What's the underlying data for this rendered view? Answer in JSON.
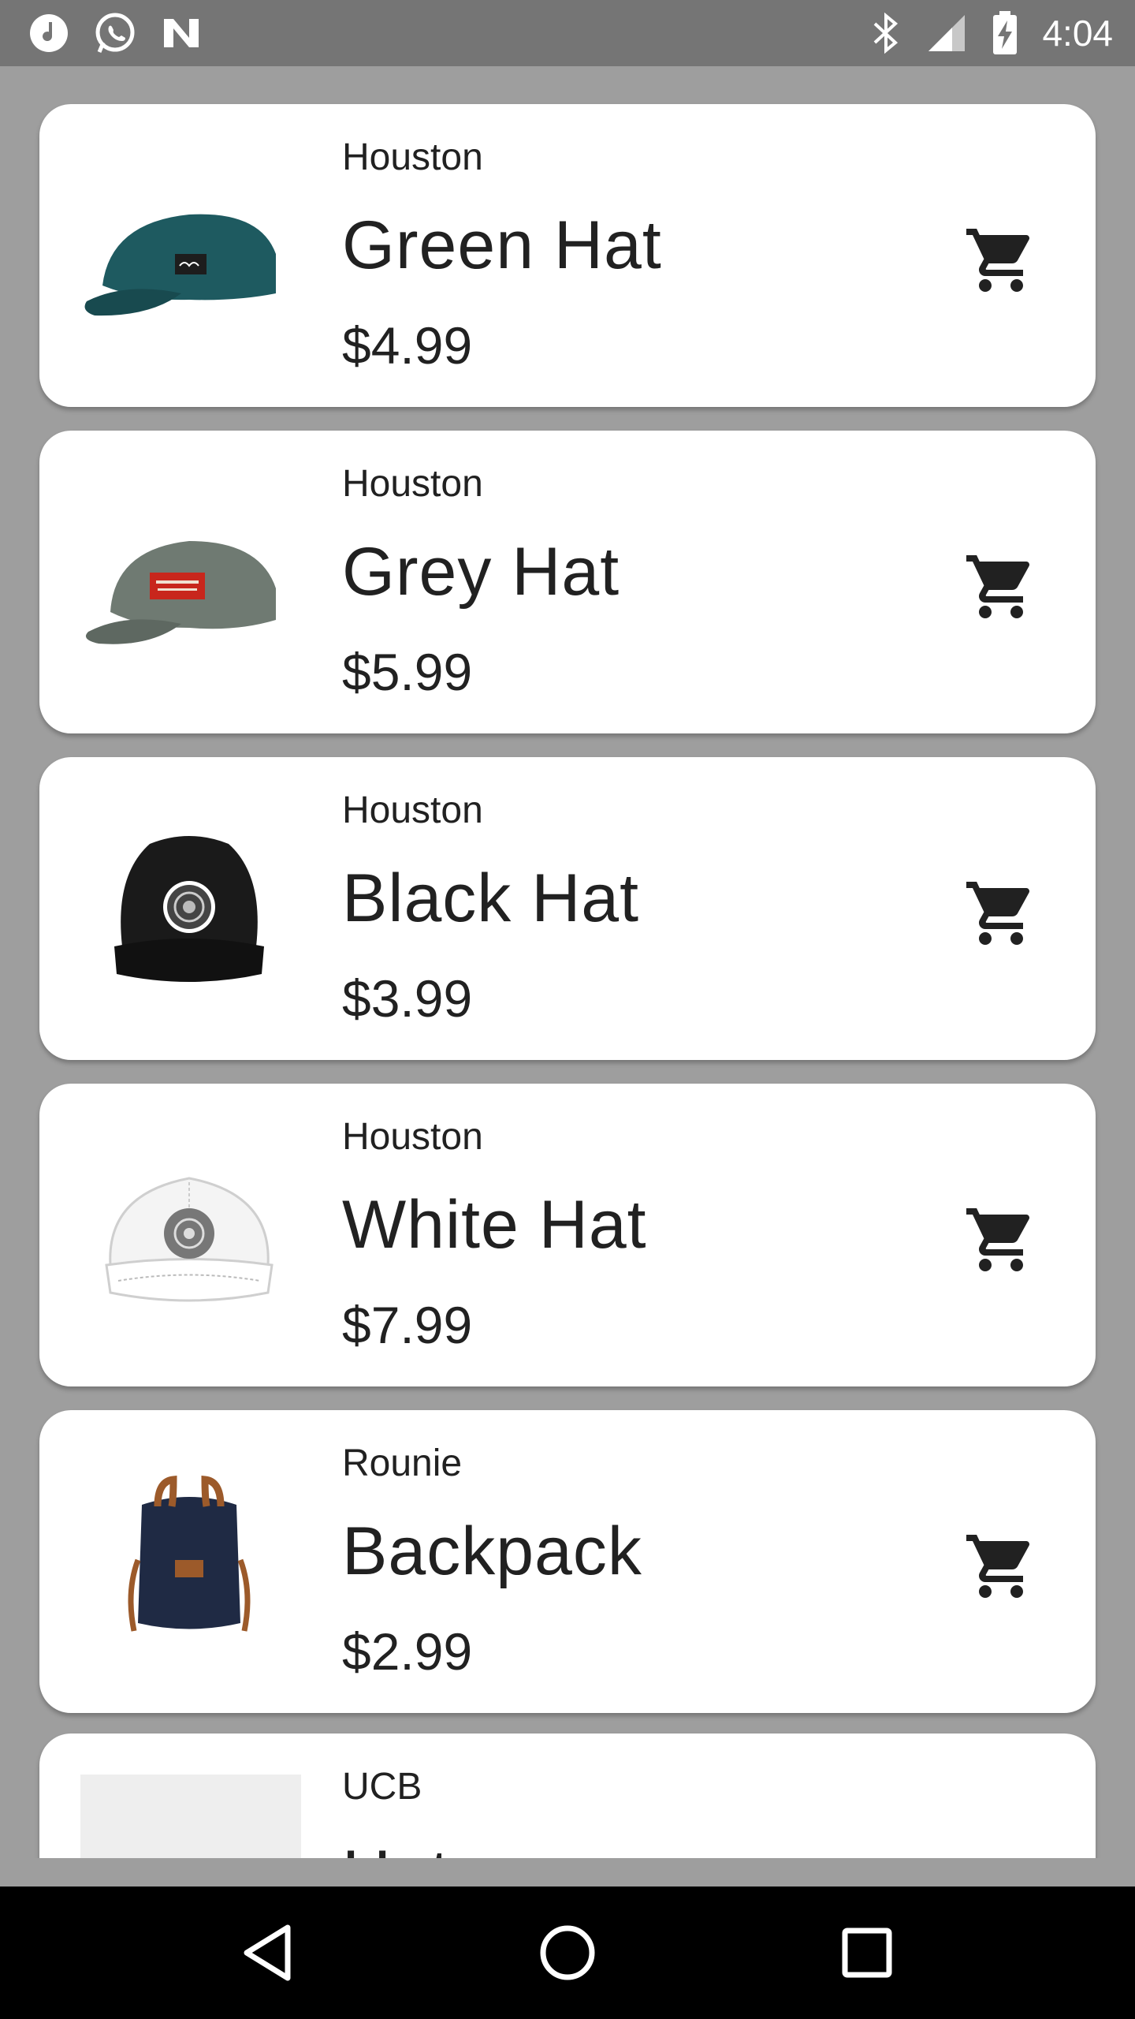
{
  "status_bar": {
    "time": "4:04",
    "left_icons": [
      "music-note-icon",
      "whatsapp-icon",
      "n-app-icon"
    ],
    "right_icons": [
      "bluetooth-icon",
      "signal-icon",
      "battery-charging-icon"
    ]
  },
  "products": [
    {
      "brand": "Houston",
      "name": "Green Hat",
      "price": "$4.99",
      "image": "green-cap",
      "color": "#1e5a60"
    },
    {
      "brand": "Houston",
      "name": "Grey Hat",
      "price": "$5.99",
      "image": "grey-cap",
      "color": "#6f7a72"
    },
    {
      "brand": "Houston",
      "name": "Black Hat",
      "price": "$3.99",
      "image": "black-cap",
      "color": "#1a1a1a"
    },
    {
      "brand": "Houston",
      "name": "White Hat",
      "price": "$7.99",
      "image": "white-cap",
      "color": "#f2f2f2"
    },
    {
      "brand": "Rounie",
      "name": "Backpack",
      "price": "$2.99",
      "image": "backpack",
      "color": "#1f2a44"
    },
    {
      "brand": "UCB",
      "name": "Hat",
      "price": "",
      "image": "placeholder",
      "color": "#eeeeee"
    }
  ],
  "nav_bar": {
    "icons": [
      "back-icon",
      "home-icon",
      "recents-icon"
    ]
  }
}
